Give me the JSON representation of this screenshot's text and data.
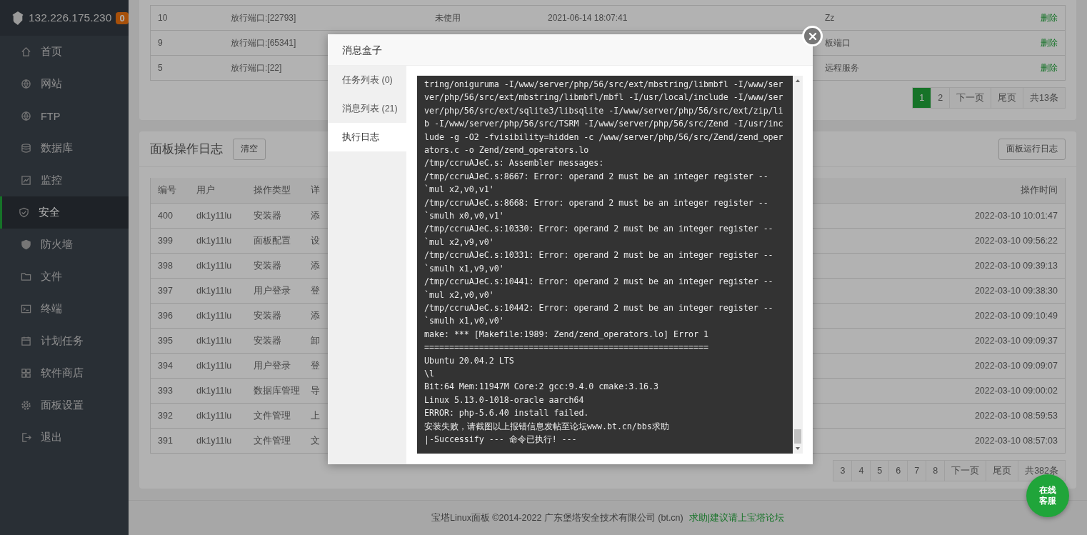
{
  "sidebar": {
    "host": "132.226.175.230",
    "badge": "0",
    "items": [
      {
        "label": "首页",
        "selected": false
      },
      {
        "label": "网站",
        "selected": false
      },
      {
        "label": "FTP",
        "selected": false
      },
      {
        "label": "数据库",
        "selected": false
      },
      {
        "label": "监控",
        "selected": false
      },
      {
        "label": "安全",
        "selected": true
      },
      {
        "label": "防火墙",
        "selected": false
      },
      {
        "label": "文件",
        "selected": false
      },
      {
        "label": "终端",
        "selected": false
      },
      {
        "label": "计划任务",
        "selected": false
      },
      {
        "label": "软件商店",
        "selected": false
      },
      {
        "label": "面板设置",
        "selected": false
      },
      {
        "label": "退出",
        "selected": false
      }
    ]
  },
  "port_table": {
    "rows": [
      {
        "id": "10",
        "port": "放行端口:[22793]",
        "status": "未使用",
        "time": "2021-06-14 18:07:41",
        "note": "Zz",
        "action": "删除"
      },
      {
        "id": "9",
        "port": "放行端口:[65341]",
        "note": "板端口",
        "action": "删除"
      },
      {
        "id": "5",
        "port": "放行端口:[22]",
        "note": "远程服务",
        "action": "删除"
      }
    ],
    "pagination": {
      "pages": [
        {
          "label": "1",
          "selected": true
        },
        {
          "label": "2",
          "selected": false
        }
      ],
      "next": "下一页",
      "last": "尾页",
      "total": "共13条"
    }
  },
  "log_card": {
    "title": "面板操作日志",
    "clear_button": "清空",
    "run_log_button": "面板运行日志",
    "columns": [
      "编号",
      "用户",
      "操作类型",
      "详",
      "操作时间"
    ],
    "rows": [
      {
        "id": "400",
        "user": "dk1y11lu",
        "type": "安装器",
        "detail": "添",
        "time": "2022-03-10 10:01:47"
      },
      {
        "id": "399",
        "user": "dk1y11lu",
        "type": "面板配置",
        "detail": "设",
        "time": "2022-03-10 09:56:22"
      },
      {
        "id": "398",
        "user": "dk1y11lu",
        "type": "安装器",
        "detail": "添",
        "time": "2022-03-10 09:39:13"
      },
      {
        "id": "397",
        "user": "dk1y11lu",
        "type": "用户登录",
        "detail": "登",
        "time": "2022-03-10 09:38:30"
      },
      {
        "id": "396",
        "user": "dk1y11lu",
        "type": "安装器",
        "detail": "添",
        "time": "2022-03-10 09:10:49"
      },
      {
        "id": "395",
        "user": "dk1y11lu",
        "type": "安装器",
        "detail": "卸",
        "time": "2022-03-10 09:09:37"
      },
      {
        "id": "394",
        "user": "dk1y11lu",
        "type": "用户登录",
        "detail": "登",
        "time": "2022-03-10 09:09:07"
      },
      {
        "id": "393",
        "user": "dk1y11lu",
        "type": "数据库管理",
        "detail": "导",
        "time": "2022-03-10 09:00:02"
      },
      {
        "id": "392",
        "user": "dk1y11lu",
        "type": "文件管理",
        "detail": "上",
        "time": "2022-03-10 08:59:53"
      },
      {
        "id": "391",
        "user": "dk1y11lu",
        "type": "文件管理",
        "detail": "文",
        "time": "2022-03-10 08:57:03"
      }
    ],
    "pagination": {
      "pages": [
        {
          "label": "3",
          "selected": false
        },
        {
          "label": "4",
          "selected": false
        },
        {
          "label": "5",
          "selected": false
        },
        {
          "label": "6",
          "selected": false
        },
        {
          "label": "7",
          "selected": false
        },
        {
          "label": "8",
          "selected": false
        }
      ],
      "next": "下一页",
      "last": "尾页",
      "total": "共382条"
    }
  },
  "footer": {
    "copyright": "宝塔Linux面板 ©2014-2022 广东堡塔安全技术有限公司 (bt.cn)",
    "link": "求助|建议请上宝塔论坛"
  },
  "chat_button": "在线客服",
  "modal": {
    "title": "消息盒子",
    "tabs": [
      {
        "label": "任务列表 (0)",
        "selected": false
      },
      {
        "label": "消息列表 (21)",
        "selected": false
      },
      {
        "label": "执行日志",
        "selected": true
      }
    ],
    "log_lines": [
      "tring/oniguruma -I/www/server/php/56/src/ext/mbstring/libmbfl -I/www/server/php/56/src/ext/mbstring/libmbfl/mbfl -I/usr/local/include -I/www/server/php/56/src/ext/sqlite3/libsqlite -I/www/server/php/56/src/ext/zip/lib -I/www/server/php/56/src/TSRM -I/www/server/php/56/src/Zend -I/usr/include -g -O2 -fvisibility=hidden -c /www/server/php/56/src/Zend/zend_operators.c -o Zend/zend_operators.lo",
      "/tmp/ccruAJeC.s: Assembler messages:",
      "/tmp/ccruAJeC.s:8667: Error: operand 2 must be an integer register --",
      "`mul x2,v0,v1'",
      "/tmp/ccruAJeC.s:8668: Error: operand 2 must be an integer register --",
      "`smulh x0,v0,v1'",
      "/tmp/ccruAJeC.s:10330: Error: operand 2 must be an integer register --",
      "`mul x2,v9,v0'",
      "/tmp/ccruAJeC.s:10331: Error: operand 2 must be an integer register --",
      "`smulh x1,v9,v0'",
      "/tmp/ccruAJeC.s:10441: Error: operand 2 must be an integer register --",
      "`mul x2,v0,v0'",
      "/tmp/ccruAJeC.s:10442: Error: operand 2 must be an integer register --",
      "`smulh x1,v0,v0'",
      "make: *** [Makefile:1989: Zend/zend_operators.lo] Error 1",
      "=========================================================",
      "Ubuntu 20.04.2 LTS",
      "\\l",
      "Bit:64 Mem:11947M Core:2 gcc:9.4.0 cmake:3.16.3",
      "Linux 5.13.0-1018-oracle aarch64",
      "ERROR: php-5.6.40 install failed.",
      "安装失败，请截图以上报错信息发帖至论坛www.bt.cn/bbs求助",
      "|-Successify --- 命令已执行! ---"
    ]
  }
}
